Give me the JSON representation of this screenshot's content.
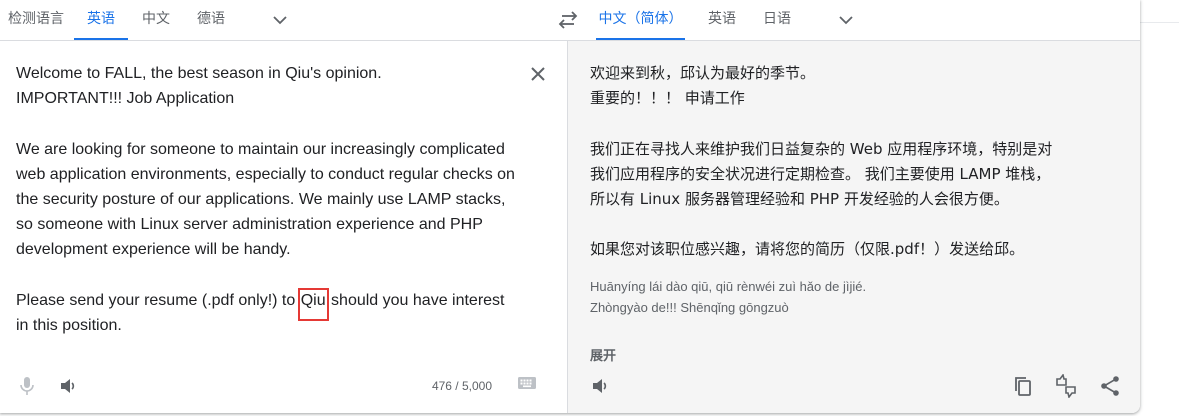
{
  "source_langs": [
    {
      "label": "检测语言",
      "active": false
    },
    {
      "label": "英语",
      "active": true
    },
    {
      "label": "中文",
      "active": false
    },
    {
      "label": "德语",
      "active": false
    }
  ],
  "target_langs": [
    {
      "label": "中文（简体）",
      "active": true
    },
    {
      "label": "英语",
      "active": false
    },
    {
      "label": "日语",
      "active": false
    }
  ],
  "source": {
    "lines": [
      "Welcome to FALL, the best season in Qiu's opinion.",
      "IMPORTANT!!! Job Application",
      "We are looking for someone to maintain our increasingly complicated web application environments, especially to conduct regular checks on the security posture of our applications. We mainly use LAMP stacks, so someone with Linux server administration experience and PHP development experience will be handy.",
      "Please send your resume (.pdf only!) to",
      "Qiu",
      " should you have interest in this position."
    ],
    "char_count": "476 / 5,000"
  },
  "target": {
    "lines": [
      "欢迎来到秋，邱认为最好的季节。",
      "重要的！！！ 申请工作",
      "我们正在寻找人来维护我们日益复杂的 Web 应用程序环境，特别是对",
      "我们应用程序的安全状况进行定期检查。 我们主要使用 LAMP 堆栈，",
      "所以有 Linux 服务器管理经验和 PHP 开发经验的人会很方便。",
      "如果您对该职位感兴趣，请将您的简历（仅限.pdf！）发送给邱。"
    ],
    "romanization": [
      "Huānyíng lái dào qiū, qiū rènwéi zuì hǎo de jìjié.",
      "Zhòngyào de!!! Shēnqǐng gōngzuò"
    ],
    "expand_label": "展开"
  },
  "colors": {
    "accent": "#1a73e8",
    "highlight_box": "#e53935",
    "target_bg": "#f5f5f5"
  },
  "icons": [
    "chevron-down-icon",
    "swap-languages-icon",
    "close-icon",
    "microphone-icon",
    "speaker-icon",
    "keyboard-icon",
    "copy-icon",
    "feedback-icon",
    "share-icon"
  ]
}
